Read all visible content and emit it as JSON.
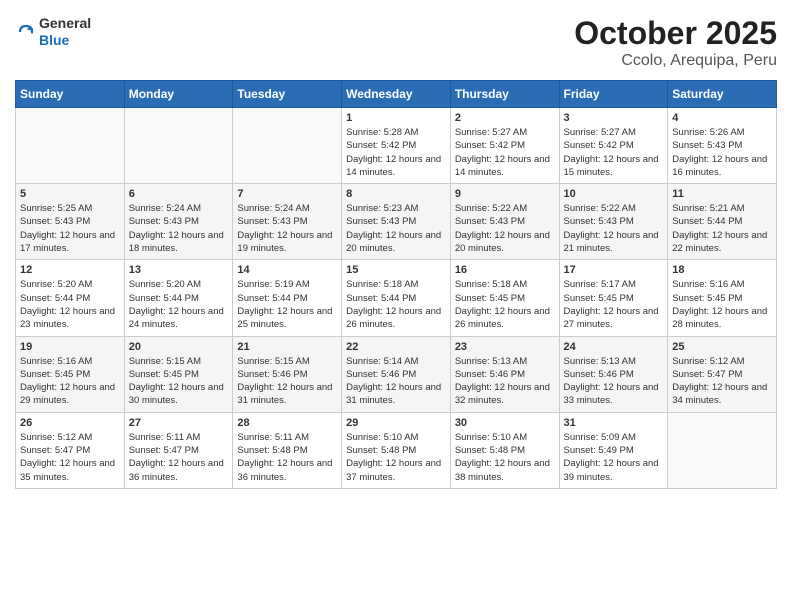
{
  "header": {
    "logo": {
      "line1": "General",
      "line2": "Blue"
    },
    "title": "October 2025",
    "subtitle": "Ccolo, Arequipa, Peru"
  },
  "weekdays": [
    "Sunday",
    "Monday",
    "Tuesday",
    "Wednesday",
    "Thursday",
    "Friday",
    "Saturday"
  ],
  "weeks": [
    [
      {
        "day": "",
        "info": ""
      },
      {
        "day": "",
        "info": ""
      },
      {
        "day": "",
        "info": ""
      },
      {
        "day": "1",
        "info": "Sunrise: 5:28 AM\nSunset: 5:42 PM\nDaylight: 12 hours\nand 14 minutes."
      },
      {
        "day": "2",
        "info": "Sunrise: 5:27 AM\nSunset: 5:42 PM\nDaylight: 12 hours\nand 14 minutes."
      },
      {
        "day": "3",
        "info": "Sunrise: 5:27 AM\nSunset: 5:42 PM\nDaylight: 12 hours\nand 15 minutes."
      },
      {
        "day": "4",
        "info": "Sunrise: 5:26 AM\nSunset: 5:43 PM\nDaylight: 12 hours\nand 16 minutes."
      }
    ],
    [
      {
        "day": "5",
        "info": "Sunrise: 5:25 AM\nSunset: 5:43 PM\nDaylight: 12 hours\nand 17 minutes."
      },
      {
        "day": "6",
        "info": "Sunrise: 5:24 AM\nSunset: 5:43 PM\nDaylight: 12 hours\nand 18 minutes."
      },
      {
        "day": "7",
        "info": "Sunrise: 5:24 AM\nSunset: 5:43 PM\nDaylight: 12 hours\nand 19 minutes."
      },
      {
        "day": "8",
        "info": "Sunrise: 5:23 AM\nSunset: 5:43 PM\nDaylight: 12 hours\nand 20 minutes."
      },
      {
        "day": "9",
        "info": "Sunrise: 5:22 AM\nSunset: 5:43 PM\nDaylight: 12 hours\nand 20 minutes."
      },
      {
        "day": "10",
        "info": "Sunrise: 5:22 AM\nSunset: 5:43 PM\nDaylight: 12 hours\nand 21 minutes."
      },
      {
        "day": "11",
        "info": "Sunrise: 5:21 AM\nSunset: 5:44 PM\nDaylight: 12 hours\nand 22 minutes."
      }
    ],
    [
      {
        "day": "12",
        "info": "Sunrise: 5:20 AM\nSunset: 5:44 PM\nDaylight: 12 hours\nand 23 minutes."
      },
      {
        "day": "13",
        "info": "Sunrise: 5:20 AM\nSunset: 5:44 PM\nDaylight: 12 hours\nand 24 minutes."
      },
      {
        "day": "14",
        "info": "Sunrise: 5:19 AM\nSunset: 5:44 PM\nDaylight: 12 hours\nand 25 minutes."
      },
      {
        "day": "15",
        "info": "Sunrise: 5:18 AM\nSunset: 5:44 PM\nDaylight: 12 hours\nand 26 minutes."
      },
      {
        "day": "16",
        "info": "Sunrise: 5:18 AM\nSunset: 5:45 PM\nDaylight: 12 hours\nand 26 minutes."
      },
      {
        "day": "17",
        "info": "Sunrise: 5:17 AM\nSunset: 5:45 PM\nDaylight: 12 hours\nand 27 minutes."
      },
      {
        "day": "18",
        "info": "Sunrise: 5:16 AM\nSunset: 5:45 PM\nDaylight: 12 hours\nand 28 minutes."
      }
    ],
    [
      {
        "day": "19",
        "info": "Sunrise: 5:16 AM\nSunset: 5:45 PM\nDaylight: 12 hours\nand 29 minutes."
      },
      {
        "day": "20",
        "info": "Sunrise: 5:15 AM\nSunset: 5:45 PM\nDaylight: 12 hours\nand 30 minutes."
      },
      {
        "day": "21",
        "info": "Sunrise: 5:15 AM\nSunset: 5:46 PM\nDaylight: 12 hours\nand 31 minutes."
      },
      {
        "day": "22",
        "info": "Sunrise: 5:14 AM\nSunset: 5:46 PM\nDaylight: 12 hours\nand 31 minutes."
      },
      {
        "day": "23",
        "info": "Sunrise: 5:13 AM\nSunset: 5:46 PM\nDaylight: 12 hours\nand 32 minutes."
      },
      {
        "day": "24",
        "info": "Sunrise: 5:13 AM\nSunset: 5:46 PM\nDaylight: 12 hours\nand 33 minutes."
      },
      {
        "day": "25",
        "info": "Sunrise: 5:12 AM\nSunset: 5:47 PM\nDaylight: 12 hours\nand 34 minutes."
      }
    ],
    [
      {
        "day": "26",
        "info": "Sunrise: 5:12 AM\nSunset: 5:47 PM\nDaylight: 12 hours\nand 35 minutes."
      },
      {
        "day": "27",
        "info": "Sunrise: 5:11 AM\nSunset: 5:47 PM\nDaylight: 12 hours\nand 36 minutes."
      },
      {
        "day": "28",
        "info": "Sunrise: 5:11 AM\nSunset: 5:48 PM\nDaylight: 12 hours\nand 36 minutes."
      },
      {
        "day": "29",
        "info": "Sunrise: 5:10 AM\nSunset: 5:48 PM\nDaylight: 12 hours\nand 37 minutes."
      },
      {
        "day": "30",
        "info": "Sunrise: 5:10 AM\nSunset: 5:48 PM\nDaylight: 12 hours\nand 38 minutes."
      },
      {
        "day": "31",
        "info": "Sunrise: 5:09 AM\nSunset: 5:49 PM\nDaylight: 12 hours\nand 39 minutes."
      },
      {
        "day": "",
        "info": ""
      }
    ]
  ]
}
